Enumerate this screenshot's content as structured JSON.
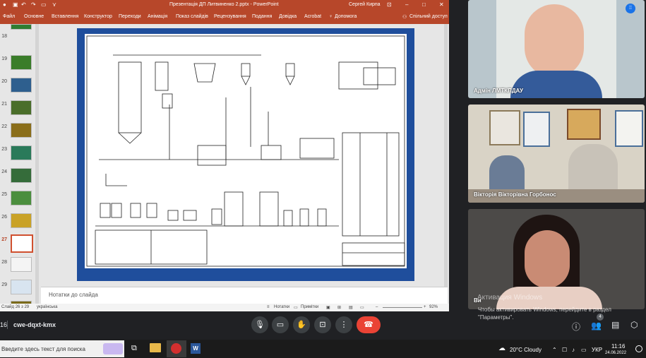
{
  "powerpoint": {
    "window_title": "Презентація ДП Литвиненко 2.pptx  -  PowerPoint",
    "user_name": "Сергей Кирпа",
    "tabs": [
      "Файл",
      "Основне",
      "Вставлення",
      "Конструктор",
      "Переходи",
      "Анімація",
      "Показ слайдів",
      "Рецензування",
      "Подання",
      "Довідка",
      "Acrobat"
    ],
    "help_label": "Допомога",
    "share_label": "Спільний доступ",
    "thumbnails": [
      "18",
      "19",
      "20",
      "21",
      "22",
      "23",
      "24",
      "25",
      "26",
      "27",
      "28",
      "29"
    ],
    "selected_thumbnail": "26",
    "notes_placeholder": "Нотатки до слайда",
    "status": {
      "slide_info": "Слайд 26 з 29",
      "language": "українська",
      "notes_button": "Нотатки",
      "comments_button": "Примітки",
      "zoom": "92%"
    }
  },
  "participants": [
    {
      "name": "Адмін ЛМТКПДАУ"
    },
    {
      "name": "Вікторія Вікторівна Горбонос"
    },
    {
      "name": "Ви"
    }
  ],
  "meeting": {
    "time": "16",
    "code": "cwe-dqxt-kmx",
    "participant_count": "4",
    "activation_line1": "Активация Windows",
    "activation_line2": "Чтобы активировать Windows, перейдите в раздел",
    "activation_line3": "\"Параметры\"."
  },
  "taskbar": {
    "search_placeholder": "Введите здесь текст для поиска",
    "weather": "20°C  Cloudy",
    "language": "УКР",
    "clock_time": "11:16",
    "clock_date": "24.06.2022"
  },
  "colors": {
    "ppt_accent": "#b7472a",
    "end_call": "#ea4335",
    "slide_frame": "#1f4e9c"
  }
}
